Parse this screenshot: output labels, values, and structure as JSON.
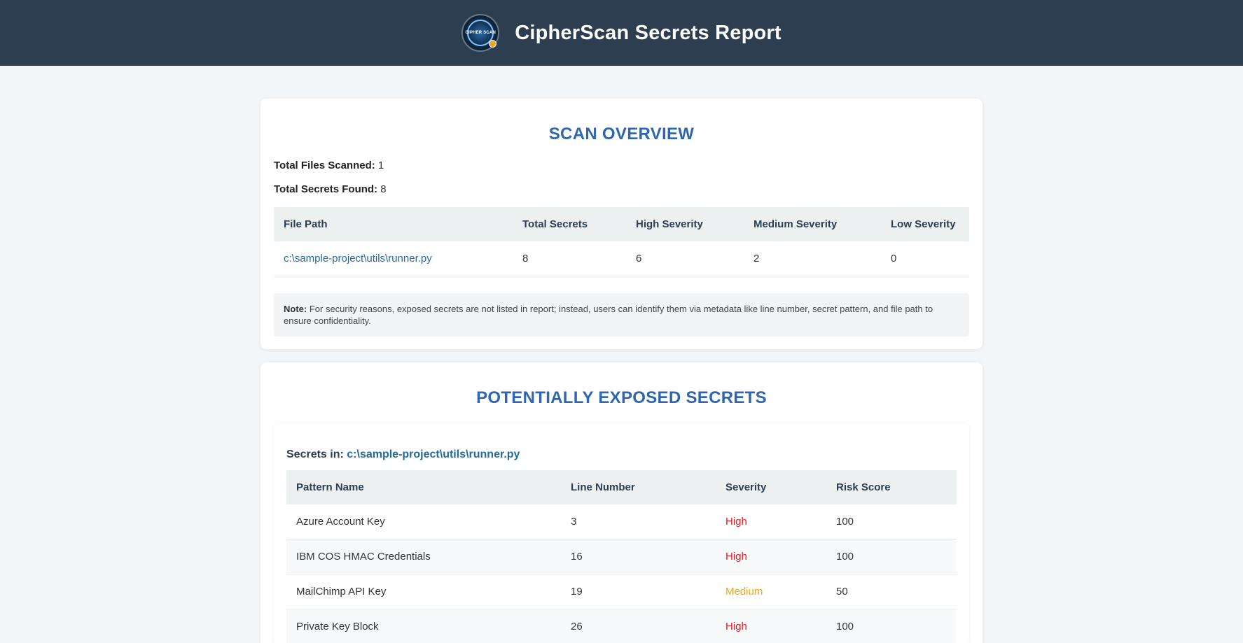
{
  "header": {
    "logo_text": "CIPHER SCAN",
    "title": "CipherScan Secrets Report"
  },
  "overview": {
    "title": "SCAN OVERVIEW",
    "files_scanned_label": "Total Files Scanned:",
    "files_scanned_value": "1",
    "secrets_found_label": "Total Secrets Found:",
    "secrets_found_value": "8",
    "columns": [
      "File Path",
      "Total Secrets",
      "High Severity",
      "Medium Severity",
      "Low Severity"
    ],
    "rows": [
      {
        "file_path": "c:\\sample-project\\utils\\runner.py",
        "total": "8",
        "high": "6",
        "medium": "2",
        "low": "0"
      }
    ],
    "note_label": "Note:",
    "note_text": "For security reasons, exposed secrets are not listed in report; instead, users can identify them via metadata like line number, secret pattern, and file path to ensure confidentiality."
  },
  "secrets": {
    "title": "POTENTIALLY EXPOSED SECRETS",
    "secrets_in_label": "Secrets in:",
    "file_path": "c:\\sample-project\\utils\\runner.py",
    "columns": [
      "Pattern Name",
      "Line Number",
      "Severity",
      "Risk Score"
    ],
    "rows": [
      {
        "pattern": "Azure Account Key",
        "line": "3",
        "severity": "High",
        "risk": "100"
      },
      {
        "pattern": "IBM COS HMAC Credentials",
        "line": "16",
        "severity": "High",
        "risk": "100"
      },
      {
        "pattern": "MailChimp API Key",
        "line": "19",
        "severity": "Medium",
        "risk": "50"
      },
      {
        "pattern": "Private Key Block",
        "line": "26",
        "severity": "High",
        "risk": "100"
      }
    ]
  },
  "colors": {
    "header_bg": "#2d3e50",
    "accent_blue": "#2f66b0",
    "link": "#246a9c",
    "severity_high": "#e21b23",
    "severity_medium": "#f0a51a"
  }
}
